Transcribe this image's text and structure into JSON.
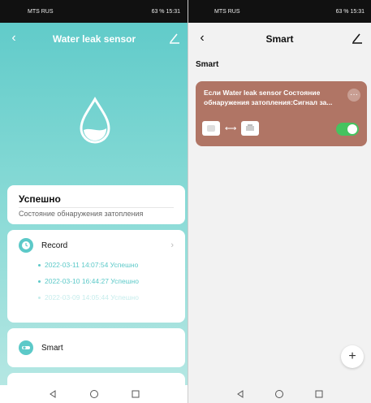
{
  "left": {
    "statusbar": {
      "carrier": "MTS RUS",
      "right": "63 % 15:31"
    },
    "header": {
      "title": "Water leak sensor"
    },
    "status_card": {
      "title": "Успешно",
      "subtitle": "Состояние обнаружения затопления"
    },
    "record": {
      "label": "Record",
      "items": [
        "2022-03-11 14:07:54 Успешно",
        "2022-03-10 16:44:27 Успешно",
        "2022-03-09 14:05:44 Успешно"
      ]
    },
    "smart": {
      "label": "Smart"
    }
  },
  "right": {
    "statusbar": {
      "carrier": "MTS RUS",
      "right": "63 % 15:31"
    },
    "header": {
      "title": "Smart"
    },
    "section_label": "Smart",
    "scene": {
      "text": "Если Water leak sensor Состояние обнаружения затопления:Сигнал за...",
      "enabled": true
    }
  },
  "colors": {
    "accent": "#5cc9c8",
    "scene_card": "#b07565",
    "toggle_on": "#45c35f"
  },
  "icons": [
    "back-icon",
    "edit-icon",
    "water-drop-icon",
    "clock-icon",
    "chevron-right-icon",
    "smart-icon",
    "more-icon",
    "sensor-icon",
    "arrow-icon",
    "device-icon",
    "toggle-switch",
    "add-icon",
    "nav-back-icon",
    "nav-home-icon",
    "nav-recent-icon"
  ]
}
